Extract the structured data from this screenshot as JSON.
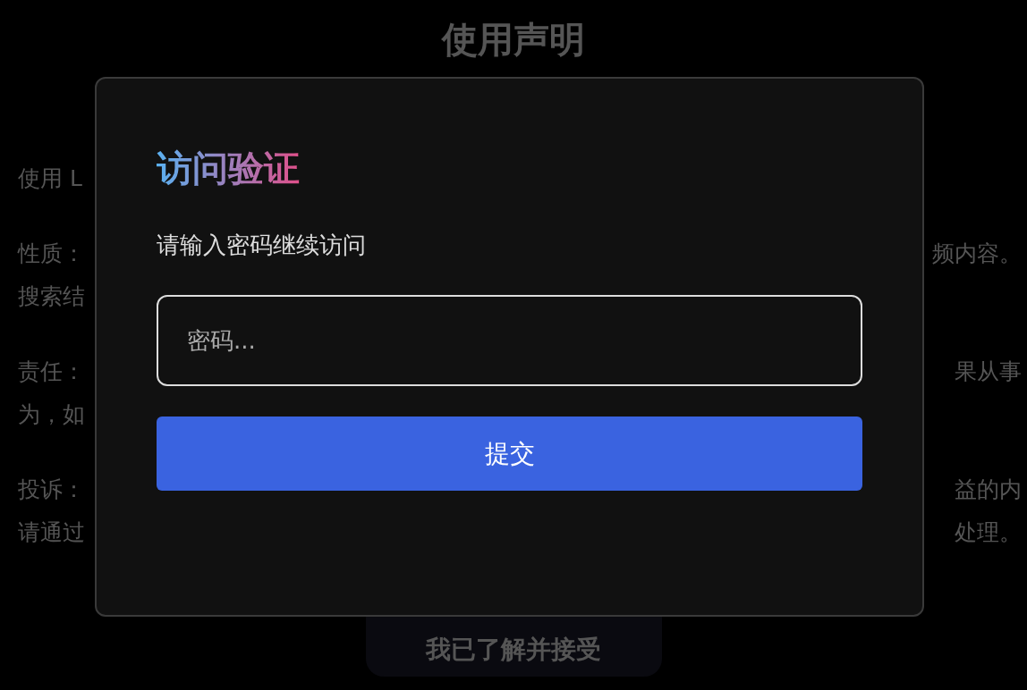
{
  "page": {
    "title": "使用声明",
    "lines": [
      {
        "left": "使用 L"
      },
      {
        "left": "性质：",
        "right": "频内容。"
      },
      {
        "left": "搜索结"
      },
      {
        "left": "责任：",
        "right": "果从事"
      },
      {
        "left": "为，如"
      },
      {
        "left": "投诉：",
        "right": "益的内"
      },
      {
        "left": "请通过",
        "right": "处理。"
      }
    ],
    "accept_button": "我已了解并接受"
  },
  "dialog": {
    "title": "访问验证",
    "prompt": "请输入密码继续访问",
    "password": {
      "placeholder": "密码..."
    },
    "submit": "提交"
  }
}
